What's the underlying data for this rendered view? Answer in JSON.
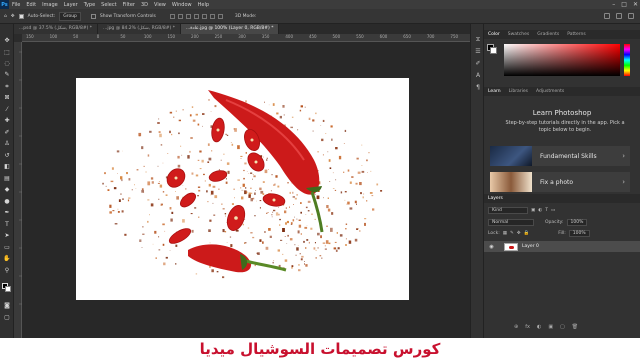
{
  "app": {
    "logo": "Ps",
    "menu": [
      "File",
      "Edit",
      "Image",
      "Layer",
      "Type",
      "Select",
      "Filter",
      "3D",
      "View",
      "Window",
      "Help"
    ],
    "window_controls": [
      "–",
      "□",
      "✕"
    ]
  },
  "options": {
    "auto_select_label": "Auto-Select:",
    "auto_select_value": "Group",
    "show_transform_label": "Show Transform Controls",
    "mode_3d_label": "3D Mode:"
  },
  "document_tabs": [
    "...psd @ 37.5% (شكل, RGB/8#) *",
    "...jpg @ 84.2% (شكل, RGB/8#) *",
    "...عادة.jpg @ 100% (Layer 0, RGB/8#) *"
  ],
  "ruler_labels": [
    "150",
    "100",
    "50",
    "0",
    "50",
    "100",
    "150",
    "200",
    "250",
    "300",
    "350",
    "400",
    "450",
    "500",
    "550",
    "600",
    "650",
    "700",
    "750"
  ],
  "panels": {
    "color_tabs": [
      "Color",
      "Swatches",
      "Gradients",
      "Patterns"
    ],
    "learn_tabs": [
      "Learn",
      "Libraries",
      "Adjustments"
    ],
    "learn_title": "Learn Photoshop",
    "learn_desc": "Step-by-step tutorials directly in the app. Pick a topic below to begin.",
    "cards": [
      {
        "label": "Fundamental Skills",
        "chevron": "›"
      },
      {
        "label": "Fix a photo",
        "chevron": "›"
      }
    ],
    "layers_tab": "Layers",
    "kind_label": "Kind",
    "blend_mode": "Normal",
    "opacity_label": "Opacity:",
    "opacity_value": "100%",
    "lock_label": "Lock:",
    "fill_label": "Fill:",
    "fill_value": "100%",
    "layer_name": "Layer 0",
    "bottom_icons": [
      "⊕",
      "fx",
      "◐",
      "▣",
      "▢",
      "🗑"
    ]
  },
  "caption": "كورس تصميمات السوشيال ميديا",
  "colors": {
    "accent_red": "#c8102e",
    "chili_red": "#cc1a1a",
    "flake_brown": "#b5521e"
  }
}
